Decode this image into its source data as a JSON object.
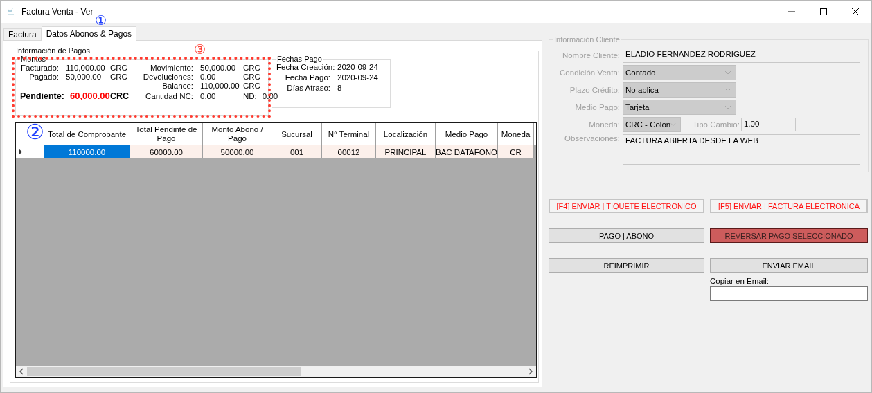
{
  "window": {
    "title": "Factura Venta - Ver"
  },
  "tabs": [
    {
      "label": "Factura",
      "selected": false
    },
    {
      "label": "Datos Abonos & Pagos",
      "selected": true
    }
  ],
  "tabs_annotation": {
    "text": "①",
    "color": "#1f3fff"
  },
  "payments_group": {
    "legend": "Información de Pagos",
    "annotation": {
      "text": "③",
      "color": "#ff3b30"
    },
    "montos": {
      "legend": "Montos",
      "highlighted": true,
      "left": [
        {
          "label": "Facturado:",
          "value": "110,000.00",
          "currency": "CRC"
        },
        {
          "label": "Pagado:",
          "value": "50,000.00",
          "currency": "CRC"
        }
      ],
      "pending": {
        "label": "Pendiente:",
        "value": "60,000.00",
        "currency": "CRC"
      },
      "right": [
        {
          "label": "Movimiento:",
          "value": "50,000.00",
          "currency": "CRC"
        },
        {
          "label": "Devoluciones:",
          "value": "0.00",
          "currency": "CRC"
        },
        {
          "label": "Balance:",
          "value": "110,000.00",
          "currency": "CRC"
        }
      ],
      "nc": {
        "label": "Cantidad NC:",
        "value": "0.00",
        "nd_label": "ND:",
        "nd_value": "0.00"
      }
    },
    "fechas": {
      "legend": "Fechas Pago",
      "rows": [
        {
          "label": "Fecha Creación:",
          "value": "2020-09-24"
        },
        {
          "label": "Fecha Pago:",
          "value": "2020-09-24"
        },
        {
          "label": "Días Atraso:",
          "value": "8"
        }
      ]
    }
  },
  "grid": {
    "annotation": {
      "text": "②",
      "color": "#1f3fff"
    },
    "columns": [
      "Total de Comprobante",
      "Total Pendinte de Pago",
      "Monto Abono / Pago",
      "Sucursal",
      "N° Terminal",
      "Localización",
      "Medio Pago",
      "Moneda"
    ],
    "rows": [
      {
        "current": true,
        "cells": [
          {
            "text": "110000.00",
            "selected": true
          },
          {
            "text": "60000.00",
            "selected": false
          },
          {
            "text": "50000.00",
            "selected": false
          },
          {
            "text": "001",
            "selected": false
          },
          {
            "text": "00012",
            "selected": false
          },
          {
            "text": "PRINCIPAL",
            "selected": false
          },
          {
            "text": "BAC DATAFONO",
            "selected": false
          },
          {
            "text": "CR",
            "selected": false
          }
        ]
      }
    ]
  },
  "client": {
    "legend": "Información Cliente",
    "disabled": true,
    "name": {
      "label": "Nombre Cliente:",
      "value": "ELADIO FERNANDEZ RODRIGUEZ"
    },
    "combos": [
      {
        "label": "Condición Venta:",
        "value": "Contado"
      },
      {
        "label": "Plazo Crédito:",
        "value": "No aplica"
      },
      {
        "label": "Medio Pago:",
        "value": "Tarjeta"
      }
    ],
    "currency": {
      "label": "Moneda:",
      "value": "CRC - Colón"
    },
    "exchange": {
      "label": "Tipo Cambio:",
      "value": "1.00"
    },
    "notes": {
      "label": "Observaciones:",
      "value": "FACTURA ABIERTA DESDE LA WEB"
    }
  },
  "buttons": [
    {
      "label": "[F4] ENVIAR | TIQUETE ELECTRONICO",
      "kind": "send"
    },
    {
      "label": "[F5] ENVIAR | FACTURA ELECTRONICA",
      "kind": "send"
    },
    {
      "label": "PAGO | ABONO",
      "kind": "normal"
    },
    {
      "label": "REVERSAR PAGO SELECCIONADO",
      "kind": "danger"
    },
    {
      "label": "REIMPRIMIR",
      "kind": "normal"
    },
    {
      "label": "ENVIAR EMAIL",
      "kind": "normal"
    }
  ],
  "email": {
    "label": "Copiar en Email:"
  }
}
